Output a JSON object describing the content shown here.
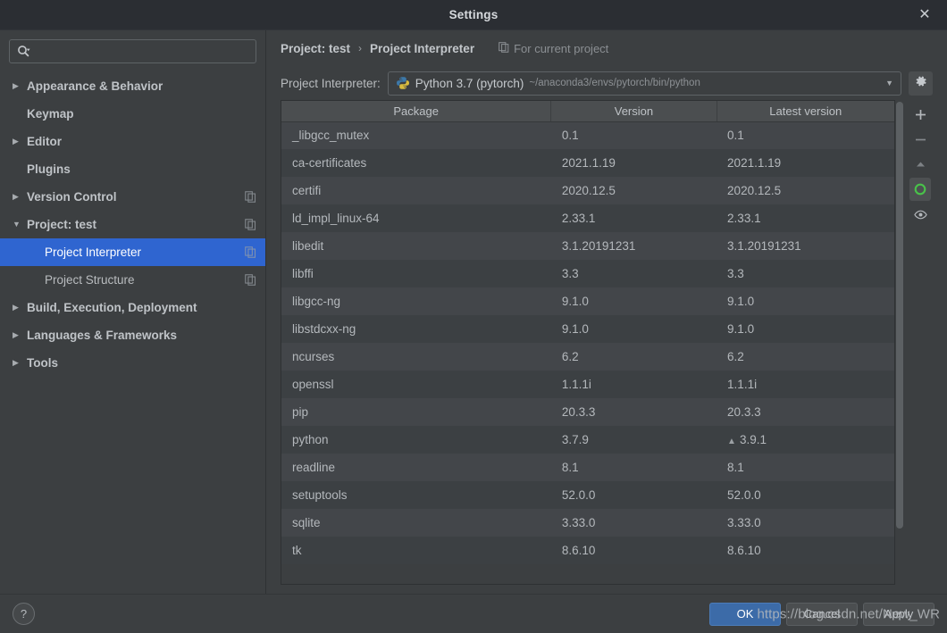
{
  "window": {
    "title": "Settings",
    "close_label": "✕"
  },
  "search": {
    "placeholder": "",
    "value": "",
    "icon": "search-icon"
  },
  "sidebar": {
    "items": [
      {
        "label": "Appearance & Behavior",
        "arrow": "▶",
        "level": 0,
        "bold": true,
        "selected": false,
        "copy": false
      },
      {
        "label": "Keymap",
        "arrow": "",
        "level": 0,
        "bold": true,
        "selected": false,
        "copy": false
      },
      {
        "label": "Editor",
        "arrow": "▶",
        "level": 0,
        "bold": true,
        "selected": false,
        "copy": false
      },
      {
        "label": "Plugins",
        "arrow": "",
        "level": 0,
        "bold": true,
        "selected": false,
        "copy": false
      },
      {
        "label": "Version Control",
        "arrow": "▶",
        "level": 0,
        "bold": true,
        "selected": false,
        "copy": true
      },
      {
        "label": "Project: test",
        "arrow": "▼",
        "level": 0,
        "bold": true,
        "selected": false,
        "copy": true
      },
      {
        "label": "Project Interpreter",
        "arrow": "",
        "level": 1,
        "bold": false,
        "selected": true,
        "copy": true
      },
      {
        "label": "Project Structure",
        "arrow": "",
        "level": 1,
        "bold": false,
        "selected": false,
        "copy": true
      },
      {
        "label": "Build, Execution, Deployment",
        "arrow": "▶",
        "level": 0,
        "bold": true,
        "selected": false,
        "copy": false
      },
      {
        "label": "Languages & Frameworks",
        "arrow": "▶",
        "level": 0,
        "bold": true,
        "selected": false,
        "copy": false
      },
      {
        "label": "Tools",
        "arrow": "▶",
        "level": 0,
        "bold": true,
        "selected": false,
        "copy": false
      }
    ]
  },
  "breadcrumb": {
    "crumb1": "Project: test",
    "separator": "›",
    "crumb2": "Project Interpreter",
    "for_current_project": "For current project"
  },
  "interpreter": {
    "label": "Project Interpreter:",
    "name": "Python 3.7 (pytorch)",
    "path": "~/anaconda3/envs/pytorch/bin/python",
    "caret": "▼",
    "gear_icon": "gear-icon"
  },
  "toolbar": {
    "add": "+",
    "remove": "−",
    "upgrade": "▲",
    "conda": "conda-icon",
    "eye": "eye-icon"
  },
  "table": {
    "columns": [
      "Package",
      "Version",
      "Latest version"
    ],
    "rows": [
      {
        "package": "_libgcc_mutex",
        "version": "0.1",
        "latest": "0.1",
        "upgradable": false
      },
      {
        "package": "ca-certificates",
        "version": "2021.1.19",
        "latest": "2021.1.19",
        "upgradable": false
      },
      {
        "package": "certifi",
        "version": "2020.12.5",
        "latest": "2020.12.5",
        "upgradable": false
      },
      {
        "package": "ld_impl_linux-64",
        "version": "2.33.1",
        "latest": "2.33.1",
        "upgradable": false
      },
      {
        "package": "libedit",
        "version": "3.1.20191231",
        "latest": "3.1.20191231",
        "upgradable": false
      },
      {
        "package": "libffi",
        "version": "3.3",
        "latest": "3.3",
        "upgradable": false
      },
      {
        "package": "libgcc-ng",
        "version": "9.1.0",
        "latest": "9.1.0",
        "upgradable": false
      },
      {
        "package": "libstdcxx-ng",
        "version": "9.1.0",
        "latest": "9.1.0",
        "upgradable": false
      },
      {
        "package": "ncurses",
        "version": "6.2",
        "latest": "6.2",
        "upgradable": false
      },
      {
        "package": "openssl",
        "version": "1.1.1i",
        "latest": "1.1.1i",
        "upgradable": false
      },
      {
        "package": "pip",
        "version": "20.3.3",
        "latest": "20.3.3",
        "upgradable": false
      },
      {
        "package": "python",
        "version": "3.7.9",
        "latest": "3.9.1",
        "upgradable": true
      },
      {
        "package": "readline",
        "version": "8.1",
        "latest": "8.1",
        "upgradable": false
      },
      {
        "package": "setuptools",
        "version": "52.0.0",
        "latest": "52.0.0",
        "upgradable": false
      },
      {
        "package": "sqlite",
        "version": "3.33.0",
        "latest": "3.33.0",
        "upgradable": false
      },
      {
        "package": "tk",
        "version": "8.6.10",
        "latest": "8.6.10",
        "upgradable": false
      }
    ]
  },
  "footer": {
    "help": "?",
    "ok": "OK",
    "cancel": "Cancel",
    "apply": "Apply"
  },
  "watermark": "https://blog.csdn.net/New_WR",
  "colors": {
    "accent": "#2f65d0",
    "primary_button": "#3c6ba8",
    "window_bg": "#3c3f41",
    "titlebar_bg": "#2b2e33",
    "conda_green": "#49c24a"
  }
}
